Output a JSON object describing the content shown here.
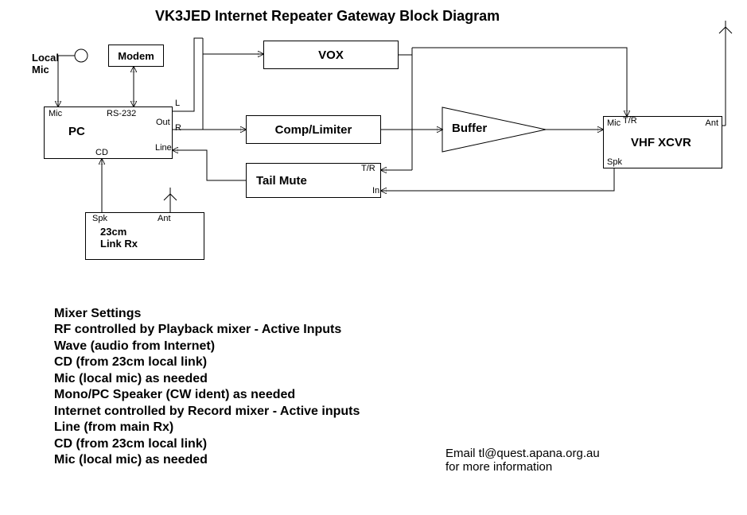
{
  "title": "VK3JED Internet Repeater Gateway Block Diagram",
  "labels": {
    "local_mic": "Local\nMic",
    "modem": "Modem",
    "pc": "PC",
    "pc_mic": "Mic",
    "pc_rs232": "RS-232",
    "pc_out": "Out",
    "pc_L": "L",
    "pc_R": "R",
    "pc_line": "Line",
    "pc_cd": "CD",
    "vox": "VOX",
    "comp": "Comp/Limiter",
    "buffer": "Buffer",
    "tail_mute": "Tail Mute",
    "tm_tr": "T/R",
    "tm_in": "In",
    "xcvr": "VHF XCVR",
    "x_mic": "Mic",
    "x_tr": "T/R",
    "x_ant": "Ant",
    "x_spk": "Spk",
    "link_rx": "23cm\nLink Rx",
    "lr_spk": "Spk",
    "lr_ant": "Ant"
  },
  "settings": {
    "heading": "Mixer Settings",
    "line1": "RF controlled by Playback mixer - Active Inputs",
    "line2": "Wave (audio from Internet)",
    "line3": "CD (from 23cm local link)",
    "line4": "Mic (local mic) as needed",
    "line5": "Mono/PC Speaker (CW ident) as needed",
    "line6": "Internet controlled by Record mixer - Active inputs",
    "line7": "Line (from main Rx)",
    "line8": "CD (from 23cm local link)",
    "line9": "Mic (local mic) as needed"
  },
  "contact": {
    "line1": "Email tl@quest.apana.org.au",
    "line2": "for more information"
  }
}
